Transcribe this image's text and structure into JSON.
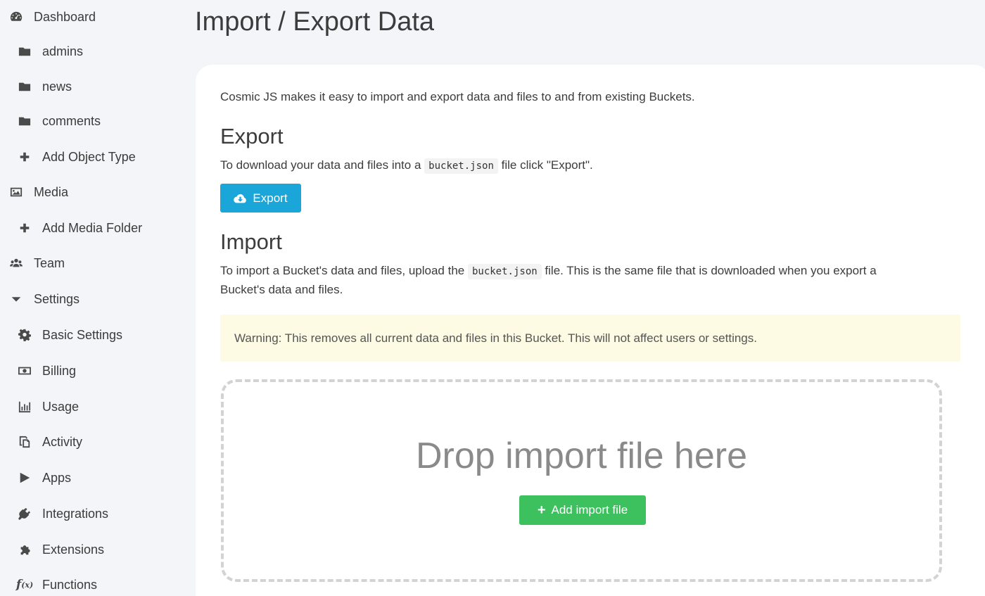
{
  "sidebar": {
    "items": [
      {
        "label": "Dashboard",
        "icon": "dashboard-icon"
      },
      {
        "label": "admins",
        "icon": "folder-icon"
      },
      {
        "label": "news",
        "icon": "folder-icon"
      },
      {
        "label": "comments",
        "icon": "folder-icon"
      },
      {
        "label": "Add Object Type",
        "icon": "plus-icon"
      },
      {
        "label": "Media",
        "icon": "image-icon"
      },
      {
        "label": "Add Media Folder",
        "icon": "plus-icon"
      },
      {
        "label": "Team",
        "icon": "users-icon"
      },
      {
        "label": "Settings",
        "icon": "caret-down-icon"
      },
      {
        "label": "Basic Settings",
        "icon": "gear-icon"
      },
      {
        "label": "Billing",
        "icon": "money-icon"
      },
      {
        "label": "Usage",
        "icon": "bar-chart-icon"
      },
      {
        "label": "Activity",
        "icon": "copy-icon"
      },
      {
        "label": "Apps",
        "icon": "play-icon"
      },
      {
        "label": "Integrations",
        "icon": "plug-icon"
      },
      {
        "label": "Extensions",
        "icon": "puzzle-icon"
      },
      {
        "label": "Functions",
        "icon": "function-icon"
      }
    ]
  },
  "page": {
    "title": "Import / Export Data",
    "intro": "Cosmic JS makes it easy to import and export data and files to and from existing Buckets."
  },
  "export": {
    "heading": "Export",
    "text_before": "To download your data and files into a",
    "code": "bucket.json",
    "text_after": "file click \"Export\".",
    "button_label": "Export"
  },
  "import": {
    "heading": "Import",
    "text_before": "To import a Bucket's data and files, upload the",
    "code": "bucket.json",
    "text_after_line1": "file. This is the same file that is downloaded when you export a",
    "text_line2": "Bucket's data and files.",
    "warning": "Warning: This removes all current data and files in this Bucket. This will not affect users or settings.",
    "drop_text": "Drop import file here",
    "add_button_label": "Add import file"
  },
  "colors": {
    "export_button": "#1aa6d9",
    "add_button": "#3dc15e",
    "warning_bg": "#fdfbe3"
  }
}
